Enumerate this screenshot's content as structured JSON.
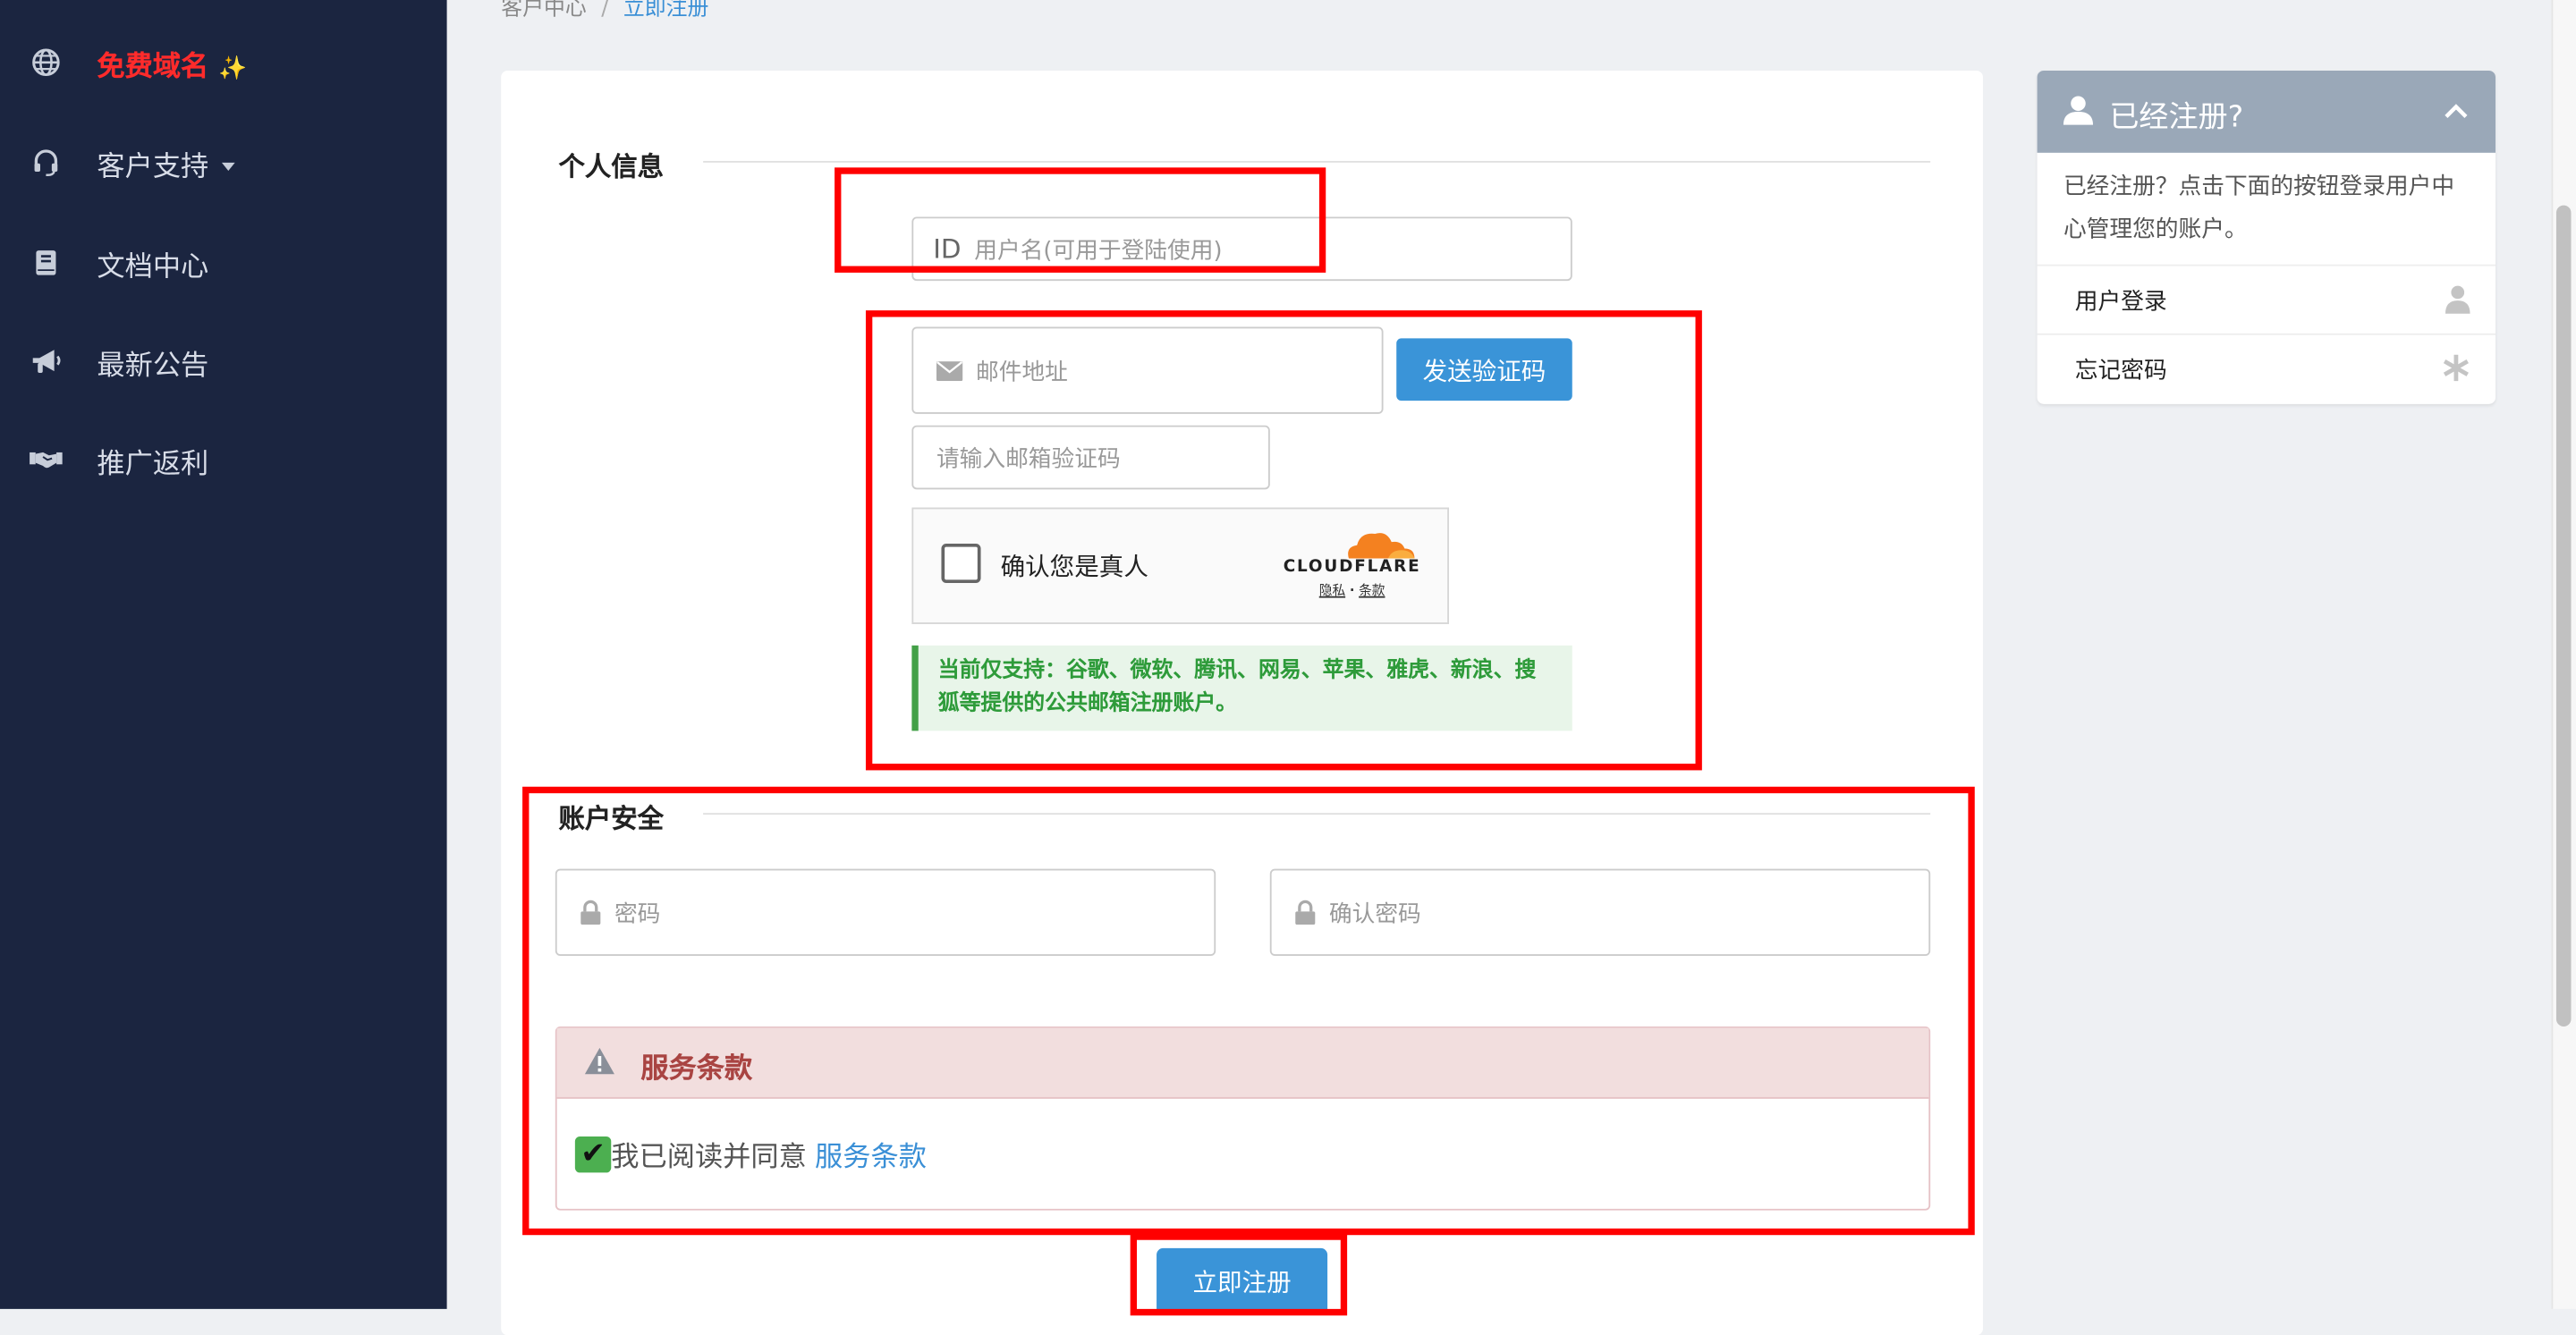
{
  "sidebar": {
    "items": [
      {
        "label": "免费域名",
        "icon": "globe-icon",
        "sparkle": "✨",
        "color": "#ff2b2b"
      },
      {
        "label": "客户支持",
        "icon": "headset-icon"
      },
      {
        "label": "文档中心",
        "icon": "book-icon"
      },
      {
        "label": "最新公告",
        "icon": "megaphone-icon"
      },
      {
        "label": "推广返利",
        "icon": "handshake-icon"
      }
    ]
  },
  "breadcrumb": {
    "parent": "客户中心",
    "separator": "/",
    "current": "立即注册"
  },
  "personal": {
    "title": "个人信息",
    "id_prefix": "ID",
    "username_placeholder": "用户名(可用于登陆使用)",
    "email_placeholder": "邮件地址",
    "send_code_label": "发送验证码",
    "code_placeholder": "请输入邮箱验证码",
    "captcha": {
      "text": "确认您是真人",
      "brand": "CLOUDFLARE",
      "privacy": "隐私",
      "dot": "·",
      "terms": "条款"
    },
    "notice": "当前仅支持：谷歌、微软、腾讯、网易、苹果、雅虎、新浪、搜狐等提供的公共邮箱注册账户。"
  },
  "security": {
    "title": "账户安全",
    "password_placeholder": "密码",
    "confirm_placeholder": "确认密码"
  },
  "terms": {
    "title": "服务条款",
    "agree_text": "我已阅读并同意",
    "link_text": "服务条款",
    "checked": true
  },
  "submit_label": "立即注册",
  "right_panel": {
    "title": "已经注册?",
    "description": "已经注册？点击下面的按钮登录用户中心管理您的账户。",
    "links": [
      {
        "label": "用户登录",
        "icon": "user-icon"
      },
      {
        "label": "忘记密码",
        "icon": "asterisk-icon"
      }
    ]
  },
  "colors": {
    "sidebar_bg": "#1b2540",
    "accent": "#3a94d8",
    "annotation": "#ff0000"
  }
}
